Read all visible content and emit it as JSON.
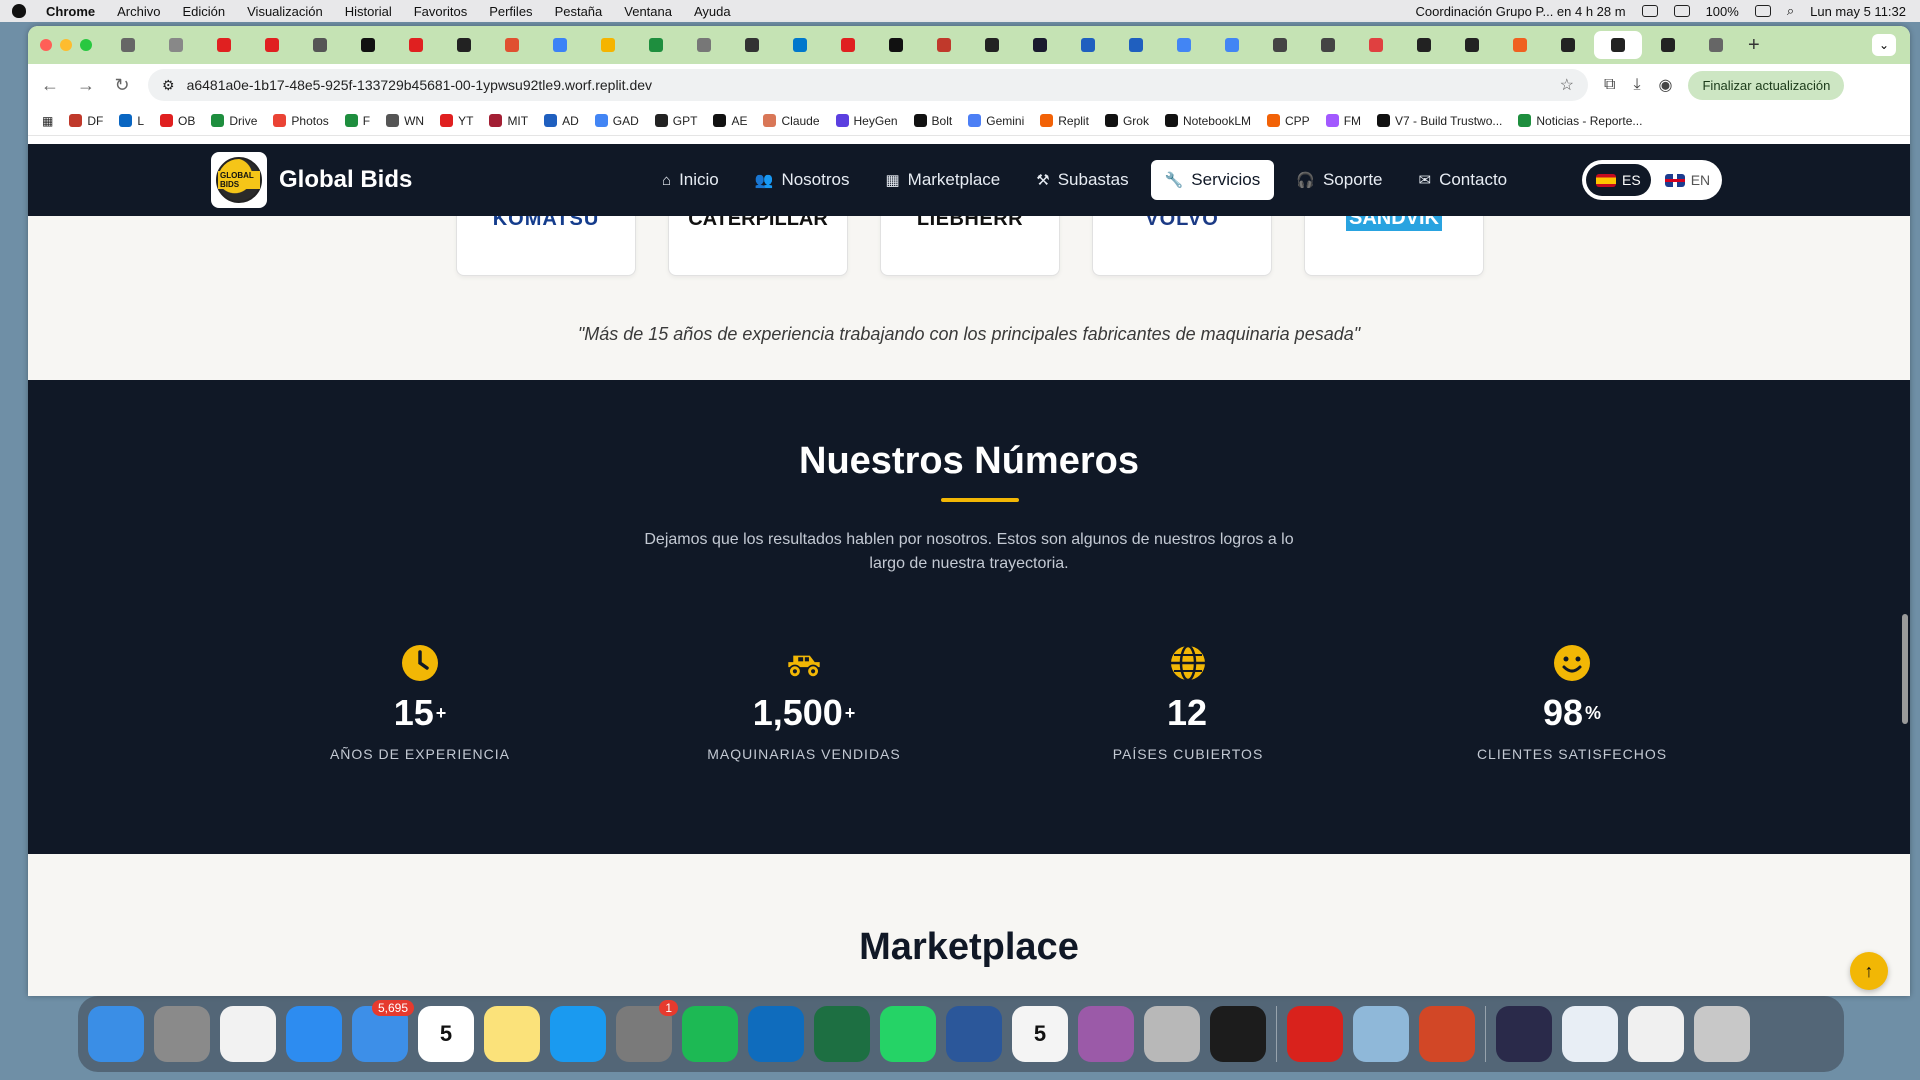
{
  "menubar": {
    "app": "Chrome",
    "items": [
      "Archivo",
      "Edición",
      "Visualización",
      "Historial",
      "Favoritos",
      "Perfiles",
      "Pestaña",
      "Ventana",
      "Ayuda"
    ],
    "event": "Coordinación Grupo P... en 4 h 28 m",
    "battery": "100%",
    "datetime": "Lun may 5  11:32"
  },
  "browser": {
    "url": "a6481a0e-1b17-48e5-925f-133729b45681-00-1ypwsu92tle9.worf.replit.dev",
    "update_button": "Finalizar actualización",
    "tab_colors": [
      "#666",
      "#888",
      "#e02020",
      "#e02020",
      "#555",
      "#111",
      "#e02020",
      "#222",
      "#e05030",
      "#3b82f6",
      "#f5b400",
      "#1e8e3e",
      "#777",
      "#333",
      "#0077cc",
      "#e02020",
      "#111",
      "#c0392b",
      "#222",
      "#1a1a2e",
      "#1f5fbf",
      "#1f5fbf",
      "#4285f4",
      "#4285f4",
      "#444",
      "#444",
      "#e04040",
      "#222",
      "#222",
      "#f06020",
      "#222",
      "#222",
      "#222",
      "#666"
    ],
    "bookmarks": [
      {
        "label": "DF",
        "color": "#c0392b"
      },
      {
        "label": "L",
        "color": "#0a66c2"
      },
      {
        "label": "OB",
        "color": "#e02020"
      },
      {
        "label": "Drive",
        "color": "#1e8e3e"
      },
      {
        "label": "Photos",
        "color": "#ea4335"
      },
      {
        "label": "F",
        "color": "#1e8e3e"
      },
      {
        "label": "WN",
        "color": "#555"
      },
      {
        "label": "YT",
        "color": "#e02020"
      },
      {
        "label": "MIT",
        "color": "#a31f34"
      },
      {
        "label": "AD",
        "color": "#1f5fbf"
      },
      {
        "label": "GAD",
        "color": "#4285f4"
      },
      {
        "label": "GPT",
        "color": "#222"
      },
      {
        "label": "AE",
        "color": "#111"
      },
      {
        "label": "Claude",
        "color": "#d97757"
      },
      {
        "label": "HeyGen",
        "color": "#5b3fe0"
      },
      {
        "label": "Bolt",
        "color": "#111"
      },
      {
        "label": "Gemini",
        "color": "#4c7ff5"
      },
      {
        "label": "Replit",
        "color": "#f26207"
      },
      {
        "label": "Grok",
        "color": "#111"
      },
      {
        "label": "NotebookLM",
        "color": "#111"
      },
      {
        "label": "CPP",
        "color": "#f26207"
      },
      {
        "label": "FM",
        "color": "#a259ff"
      },
      {
        "label": "V7 - Build Trustwo...",
        "color": "#111"
      },
      {
        "label": "Noticias - Reporte...",
        "color": "#1e8e3e"
      }
    ]
  },
  "site": {
    "brand": "Global Bids",
    "logo_text": "GLOBAL BIDS",
    "nav": [
      {
        "label": "Inicio",
        "icon": "home-icon",
        "glyph": "⌂"
      },
      {
        "label": "Nosotros",
        "icon": "users-icon",
        "glyph": "👥"
      },
      {
        "label": "Marketplace",
        "icon": "grid-icon",
        "glyph": "▦"
      },
      {
        "label": "Subastas",
        "icon": "gavel-icon",
        "glyph": "⚒"
      },
      {
        "label": "Servicios",
        "icon": "wrench-icon",
        "glyph": "🔧"
      },
      {
        "label": "Soporte",
        "icon": "headset-icon",
        "glyph": "🎧"
      },
      {
        "label": "Contacto",
        "icon": "envelope-icon",
        "glyph": "✉"
      }
    ],
    "active_nav": "Servicios",
    "languages": {
      "es": "ES",
      "en": "EN",
      "active": "ES"
    },
    "brands": [
      "KOMATSU",
      "CATERPILLAR",
      "LIEBHERR",
      "VOLVO",
      "SANDVIK"
    ],
    "quote": "\"Más de 15 años de experiencia trabajando con los principales fabricantes de maquinaria pesada\"",
    "numbers": {
      "title": "Nuestros Números",
      "description": "Dejamos que los resultados hablen por nosotros. Estos son algunos de nuestros logros a lo largo de nuestra trayectoria.",
      "accent_color": "#f2b705",
      "stats": [
        {
          "icon": "clock-icon",
          "value": "15",
          "suffix": "+",
          "label": "AÑOS DE EXPERIENCIA"
        },
        {
          "icon": "monster-truck-icon",
          "value": "1,500",
          "suffix": "+",
          "label": "MAQUINARIAS VENDIDAS"
        },
        {
          "icon": "globe-icon",
          "value": "12",
          "suffix": "",
          "label": "PAÍSES CUBIERTOS"
        },
        {
          "icon": "smile-icon",
          "value": "98",
          "suffix": "%",
          "label": "CLIENTES SATISFECHOS"
        }
      ]
    },
    "next_section_title": "Marketplace"
  },
  "dock": {
    "apps": [
      {
        "name": "finder",
        "color": "#3a8ee6"
      },
      {
        "name": "launchpad",
        "color": "#8a8a8a"
      },
      {
        "name": "chrome",
        "color": "#f2f2f2"
      },
      {
        "name": "safari",
        "color": "#2d8cf0"
      },
      {
        "name": "mail",
        "color": "#3d8fe8",
        "badge": "5,695"
      },
      {
        "name": "calendar",
        "color": "#ffffff",
        "text": "5"
      },
      {
        "name": "notes",
        "color": "#fbe27a"
      },
      {
        "name": "keynote",
        "color": "#1a9af0"
      },
      {
        "name": "settings",
        "color": "#7a7a7a",
        "badge": "1"
      },
      {
        "name": "spotify",
        "color": "#1db954"
      },
      {
        "name": "outlook",
        "color": "#0f6cbd"
      },
      {
        "name": "excel",
        "color": "#1d6f42"
      },
      {
        "name": "whatsapp",
        "color": "#25d366"
      },
      {
        "name": "word",
        "color": "#2b579a"
      },
      {
        "name": "fantastical",
        "color": "#f4f4f4",
        "text": "5"
      },
      {
        "name": "screenrecorder",
        "color": "#9b5aa8"
      },
      {
        "name": "iphone-mirroring",
        "color": "#b8b8b8"
      },
      {
        "name": "replit",
        "color": "#1c1c1c"
      },
      {
        "name": "acrobat",
        "color": "#d9221c"
      },
      {
        "name": "preview",
        "color": "#8fb8d9"
      },
      {
        "name": "powerpoint",
        "color": "#d24726"
      },
      {
        "name": "recent-doc-1",
        "color": "#2a2a4a"
      },
      {
        "name": "recent-doc-2",
        "color": "#e8eef5"
      },
      {
        "name": "recent-doc-3",
        "color": "#f0f0f0"
      },
      {
        "name": "trash",
        "color": "#c8c8c8"
      }
    ]
  }
}
